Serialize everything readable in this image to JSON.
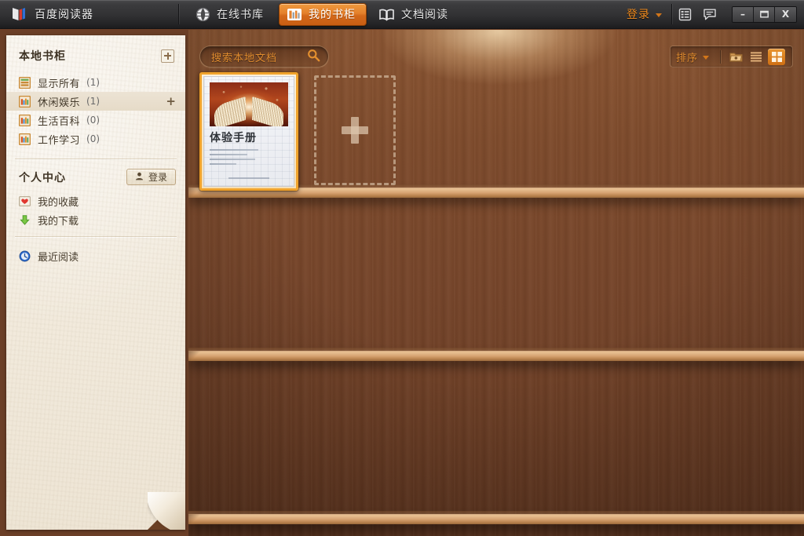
{
  "titlebar": {
    "brand_name": "百度阅读器",
    "brand_logo_icon": "book-logo-icon",
    "nav": [
      {
        "label": "在线书库",
        "icon": "globe-icon",
        "active": false
      },
      {
        "label": "我的书柜",
        "icon": "bookcase-icon",
        "active": true
      },
      {
        "label": "文档阅读",
        "icon": "open-book-icon",
        "active": false
      }
    ],
    "login_label": "登录",
    "login_caret_icon": "chevron-down-icon",
    "list_icon": "list-panel-icon",
    "chat_icon": "chat-bubble-icon",
    "window_minimize": "–",
    "window_maximize": "❐",
    "window_close": "X"
  },
  "sidebar": {
    "title": "本地书柜",
    "add_shelf_icon": "add-shelf-icon",
    "shelves": [
      {
        "label": "显示所有",
        "count": "(1)",
        "icon": "shelf-all-icon",
        "selected": false,
        "plus": ""
      },
      {
        "label": "休闲娱乐",
        "count": "(1)",
        "icon": "shelf-books-icon",
        "selected": true,
        "plus": "+"
      },
      {
        "label": "生活百科",
        "count": "(0)",
        "icon": "shelf-books-icon",
        "selected": false,
        "plus": ""
      },
      {
        "label": "工作学习",
        "count": "(0)",
        "icon": "shelf-books-icon",
        "selected": false,
        "plus": ""
      }
    ],
    "personal_title": "个人中心",
    "personal_login_label": "登录",
    "personal_login_icon": "user-icon",
    "personal_items": [
      {
        "label": "我的收藏",
        "icon": "heart-icon"
      },
      {
        "label": "我的下载",
        "icon": "download-arrow-icon"
      }
    ],
    "recent": {
      "label": "最近阅读",
      "icon": "clock-icon"
    }
  },
  "shelf_toolbar": {
    "search_placeholder": "搜索本地文档",
    "search_value": "",
    "search_icon": "search-icon",
    "sort_label": "排序",
    "sort_caret_icon": "chevron-down-icon",
    "folder_icon": "folder-open-icon",
    "list_view_icon": "list-view-icon",
    "grid_view_icon": "grid-view-icon",
    "active_view": "grid"
  },
  "books": [
    {
      "title": "体验手册",
      "cover_image": "glowing-open-book-image",
      "selected": true,
      "body_lines": [
        62,
        48,
        58,
        34
      ]
    }
  ],
  "add_slot": {
    "icon": "plus-icon",
    "label": ""
  },
  "shelves_boards": [
    239,
    447,
    655
  ],
  "colors": {
    "accent_orange": "#e4802b",
    "login_orange": "#f08c20",
    "selection_border": "#f0a32c",
    "wood_dark": "#6c3e25",
    "wood_light": "#8a5532",
    "board_tan": "#d6a271",
    "sidebar_paper": "#f3ecdf",
    "titlebar_dark": "#323234"
  }
}
